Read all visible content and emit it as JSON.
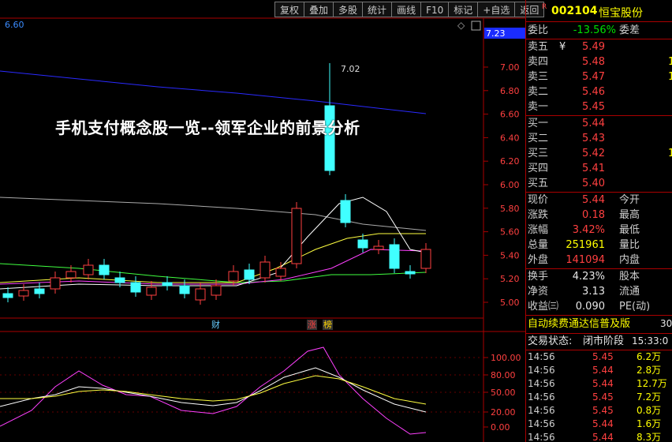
{
  "toolbar": {
    "items": [
      "复权",
      "叠加",
      "多股",
      "统计",
      "画线",
      "F10",
      "标记",
      "+自选",
      "返回"
    ]
  },
  "chart_header": {
    "left_value": "6.60",
    "right_tag": "7.23"
  },
  "price_axis": [
    "7.00",
    "6.80",
    "6.60",
    "6.40",
    "6.20",
    "6.00",
    "5.80",
    "5.60",
    "5.40",
    "5.20",
    "5.00"
  ],
  "indicator_axis": [
    "100.00",
    "80.00",
    "50.00",
    "20.00",
    "0.00"
  ],
  "annotations": {
    "high_label": "7.02",
    "marker_cai": "财",
    "marker_zhang": "涨",
    "marker_bang": "榜"
  },
  "banner": "手机支付概念股一览--领军企业的前景分析",
  "stock": {
    "code": "002104",
    "name": "恒宝股份",
    "code_prefix": "R"
  },
  "ratio": {
    "label": "委比",
    "value": "-13.56%",
    "label2": "委差"
  },
  "asks": [
    {
      "label": "卖五",
      "mark": "¥",
      "price": "5.49",
      "vol": ""
    },
    {
      "label": "卖四",
      "price": "5.48",
      "vol": "1"
    },
    {
      "label": "卖三",
      "price": "5.47",
      "vol": "1"
    },
    {
      "label": "卖二",
      "price": "5.46",
      "vol": ""
    },
    {
      "label": "卖一",
      "price": "5.45",
      "vol": ""
    }
  ],
  "bids": [
    {
      "label": "买一",
      "price": "5.44",
      "vol": ""
    },
    {
      "label": "买二",
      "price": "5.43",
      "vol": ""
    },
    {
      "label": "买三",
      "price": "5.42",
      "vol": "1"
    },
    {
      "label": "买四",
      "price": "5.41",
      "vol": ""
    },
    {
      "label": "买五",
      "price": "5.40",
      "vol": ""
    }
  ],
  "quote": [
    {
      "label": "现价",
      "value": "5.44",
      "label2": "今开",
      "cls": "red"
    },
    {
      "label": "涨跌",
      "value": "0.18",
      "label2": "最高",
      "cls": "red"
    },
    {
      "label": "涨幅",
      "value": "3.42%",
      "label2": "最低",
      "cls": "red"
    },
    {
      "label": "总量",
      "value": "251961",
      "label2": "量比",
      "cls": "yel"
    },
    {
      "label": "外盘",
      "value": "141094",
      "label2": "内盘",
      "cls": "red"
    }
  ],
  "stats": [
    {
      "label": "换手",
      "value": "4.23%",
      "label2": "股本"
    },
    {
      "label": "净资",
      "value": "3.13",
      "label2": "流通"
    },
    {
      "label": "收益㈢",
      "value": "0.090",
      "label2": "PE(动)"
    }
  ],
  "ad_text": "自动续费通达信普及版",
  "ad_tail": "30",
  "trade_status": {
    "label": "交易状态:",
    "value": "闭市阶段",
    "time": "15:33:0"
  },
  "ticks": [
    {
      "t": "14:56",
      "p": "5.45",
      "v": "6.2万"
    },
    {
      "t": "14:56",
      "p": "5.44",
      "v": "2.8万"
    },
    {
      "t": "14:56",
      "p": "5.44",
      "v": "12.7万"
    },
    {
      "t": "14:56",
      "p": "5.45",
      "v": "7.2万"
    },
    {
      "t": "14:56",
      "p": "5.45",
      "v": "0.8万"
    },
    {
      "t": "14:56",
      "p": "5.44",
      "v": "1.6万"
    },
    {
      "t": "14:56",
      "p": "5.44",
      "v": "8.3万"
    }
  ],
  "colors": {
    "up": "#ff4040",
    "down": "#00ffff",
    "border": "#aa0000",
    "ma_blue": "#2a2aff"
  }
}
